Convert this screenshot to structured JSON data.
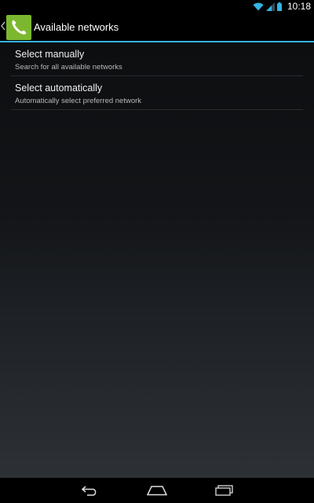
{
  "status_bar": {
    "time": "10:18",
    "icons": [
      "wifi-icon",
      "signal-icon",
      "battery-icon"
    ]
  },
  "action_bar": {
    "title": "Available networks",
    "app_icon": "phone-icon",
    "accent_color": "#33b5e5",
    "app_icon_color": "#7cb82f"
  },
  "options": [
    {
      "title": "Select manually",
      "subtitle": "Search for all available networks"
    },
    {
      "title": "Select automatically",
      "subtitle": "Automatically select preferred network"
    }
  ],
  "nav_bar": {
    "buttons": [
      "back-icon",
      "home-icon",
      "recent-apps-icon"
    ]
  }
}
